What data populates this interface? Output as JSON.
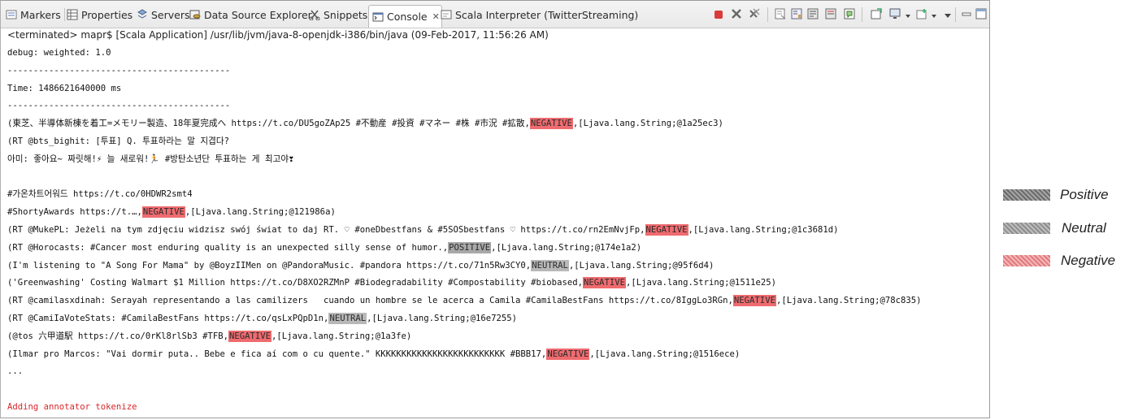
{
  "tabs": [
    {
      "label": "Markers",
      "icon": "markers-icon"
    },
    {
      "label": "Properties",
      "icon": "properties-icon"
    },
    {
      "label": "Servers",
      "icon": "servers-icon"
    },
    {
      "label": "Data Source Explorer",
      "icon": "data-source-icon"
    },
    {
      "label": "Snippets",
      "icon": "snippets-icon"
    },
    {
      "label": "Console",
      "icon": "console-icon",
      "active": true
    },
    {
      "label": "Scala Interpreter (TwitterStreaming)",
      "icon": "scala-interpreter-icon"
    }
  ],
  "console": {
    "status": "<terminated> mapr$ [Scala Application] /usr/lib/jvm/java-8-openjdk-i386/bin/java (09-Feb-2017, 11:56:26 AM)",
    "lines": [
      {
        "segments": [
          {
            "t": "debug: weighted: 1.0"
          }
        ]
      },
      {
        "segments": [
          {
            "t": "-------------------------------------------"
          }
        ]
      },
      {
        "segments": [
          {
            "t": "Time: 1486621640000 ms"
          }
        ]
      },
      {
        "segments": [
          {
            "t": "-------------------------------------------"
          }
        ]
      },
      {
        "segments": [
          {
            "t": "(東芝、半導体新棟を着工=メモリー製造、18年夏完成へ https://t.co/DU5goZAp25 #不動産 #投資 #マネー #株 #市況 #拡散,"
          },
          {
            "t": "NEGATIVE",
            "tag": "neg"
          },
          {
            "t": ",[Ljava.lang.String;@1a25ec3)"
          }
        ]
      },
      {
        "segments": [
          {
            "t": "(RT @bts_bighit: [투표] Q. 투표하라는 말 지겹다?"
          }
        ]
      },
      {
        "segments": [
          {
            "t": "아미: 좋아요~ 짜릿해!⚡ 늘 새로워!🏃 #방탄소년단 투표하는 게 최고야❣"
          }
        ]
      },
      {
        "segments": [
          {
            "t": ""
          }
        ]
      },
      {
        "segments": [
          {
            "t": "#가온차트어워드 https://t.co/0HDWR2smt4"
          }
        ]
      },
      {
        "segments": [
          {
            "t": "#ShortyAwards https://t.…,"
          },
          {
            "t": "NEGATIVE",
            "tag": "neg"
          },
          {
            "t": ",[Ljava.lang.String;@121986a)"
          }
        ]
      },
      {
        "segments": [
          {
            "t": "(RT @MukePL: Jeżeli na tym zdjęciu widzisz swój świat to daj RT. ♡ #oneDbestfans & #5SOSbestfans ♡ https://t.co/rn2EmNvjFp,"
          },
          {
            "t": "NEGATIVE",
            "tag": "neg"
          },
          {
            "t": ",[Ljava.lang.String;@1c3681d)"
          }
        ]
      },
      {
        "segments": [
          {
            "t": "(RT @Horocasts: #Cancer most enduring quality is an unexpected silly sense of humor.,"
          },
          {
            "t": "POSITIVE",
            "tag": "pos"
          },
          {
            "t": ",[Ljava.lang.String;@174e1a2)"
          }
        ]
      },
      {
        "segments": [
          {
            "t": "(I'm listening to \"A Song For Mama\" by @BoyzIIMen on @PandoraMusic. #pandora https://t.co/71n5Rw3CY0,"
          },
          {
            "t": "NEUTRAL",
            "tag": "neu"
          },
          {
            "t": ",[Ljava.lang.String;@95f6d4)"
          }
        ]
      },
      {
        "segments": [
          {
            "t": "('Greenwashing' Costing Walmart $1 Million https://t.co/D8XO2RZMnP #Biodegradability #Compostability #biobased,"
          },
          {
            "t": "NEGATIVE",
            "tag": "neg"
          },
          {
            "t": ",[Ljava.lang.String;@1511e25)"
          }
        ]
      },
      {
        "segments": [
          {
            "t": "(RT @camilasxdinah: Serayah representando a las camilizers   cuando un hombre se le acerca a Camila #CamilaBestFans https://t.co/8IggLo3RGn,"
          },
          {
            "t": "NEGATIVE",
            "tag": "neg"
          },
          {
            "t": ",[Ljava.lang.String;@78c835)"
          }
        ]
      },
      {
        "segments": [
          {
            "t": "(RT @CamiIaVoteStats: #CamilaBestFans https://t.co/qsLxPQpD1n,"
          },
          {
            "t": "NEUTRAL",
            "tag": "neu"
          },
          {
            "t": ",[Ljava.lang.String;@16e7255)"
          }
        ]
      },
      {
        "segments": [
          {
            "t": "(@tos 六甲道駅 https://t.co/0rKl8rlSb3 #TFB,"
          },
          {
            "t": "NEGATIVE",
            "tag": "neg"
          },
          {
            "t": ",[Ljava.lang.String;@1a3fe)"
          }
        ]
      },
      {
        "segments": [
          {
            "t": "(Ilmar pro Marcos: \"Vai dormir puta.. Bebe e fica aí com o cu quente.\" KKKKKKKKKKKKKKKKKKKKKKKKK #BBB17,"
          },
          {
            "t": "NEGATIVE",
            "tag": "neg"
          },
          {
            "t": ",[Ljava.lang.String;@1516ece)"
          }
        ]
      },
      {
        "segments": [
          {
            "t": "..."
          }
        ]
      },
      {
        "segments": [
          {
            "t": ""
          }
        ]
      },
      {
        "segments": [
          {
            "t": "Adding annotator tokenize"
          }
        ],
        "error": true
      }
    ]
  },
  "legend": [
    {
      "label": "Positive",
      "style": "pos"
    },
    {
      "label": "Neutral",
      "style": "neu"
    },
    {
      "label": "Negative",
      "style": "neg"
    }
  ],
  "colors": {
    "negative": "#ef6b6f",
    "positive": "#a8a8a8",
    "neutral": "#b8b8b8",
    "error_text": "#d9262a"
  }
}
